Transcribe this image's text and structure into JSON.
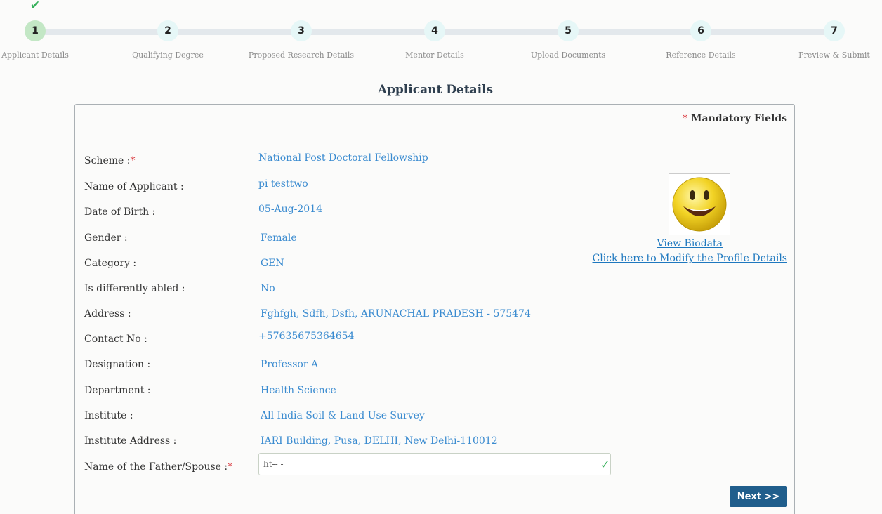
{
  "stepper": {
    "steps": [
      {
        "number": "1",
        "label": "Applicant Details"
      },
      {
        "number": "2",
        "label": "Qualifying Degree"
      },
      {
        "number": "3",
        "label": "Proposed Research Details"
      },
      {
        "number": "4",
        "label": "Mentor Details"
      },
      {
        "number": "5",
        "label": "Upload Documents"
      },
      {
        "number": "6",
        "label": "Reference Details"
      },
      {
        "number": "7",
        "label": "Preview & Submit"
      }
    ],
    "completed_check": "✔"
  },
  "page": {
    "title": "Applicant Details"
  },
  "panel": {
    "mandatory_star": "*",
    "mandatory_text": "Mandatory Fields"
  },
  "form": {
    "scheme": {
      "label": "Scheme :",
      "value": "National Post Doctoral Fellowship"
    },
    "name": {
      "label": "Name of Applicant :",
      "value": "pi testtwo"
    },
    "dob": {
      "label": "Date of Birth :",
      "value": "05-Aug-2014"
    },
    "gender": {
      "label": "Gender :",
      "value": "Female"
    },
    "category": {
      "label": "Category :",
      "value": "GEN"
    },
    "disabled": {
      "label": "Is differently abled :",
      "value": "No"
    },
    "address": {
      "label": "Address :",
      "value": "Fghfgh, Sdfh, Dsfh, ARUNACHAL PRADESH - 575474"
    },
    "contact": {
      "label": "Contact No :",
      "value": "+57635675364654"
    },
    "designation": {
      "label": "Designation :",
      "value": "Professor A"
    },
    "department": {
      "label": "Department :",
      "value": "Health Science"
    },
    "institute": {
      "label": "Institute :",
      "value": "All India Soil & Land Use Survey"
    },
    "institute_address": {
      "label": "Institute Address :",
      "value": "IARI Building, Pusa, DELHI, New Delhi-110012"
    },
    "father": {
      "label": "Name of the Father/Spouse :",
      "value": "ht-- -",
      "valid_check": "✓"
    },
    "required_star": "*"
  },
  "profile": {
    "view_biodata": "View Biodata",
    "modify_profile": "Click here to Modify the Profile Details"
  },
  "buttons": {
    "next": "Next >>"
  },
  "colors": {
    "accent": "#3a8bd0",
    "primary_button": "#205e8c",
    "success": "#35b05a",
    "required": "#d9343a"
  }
}
